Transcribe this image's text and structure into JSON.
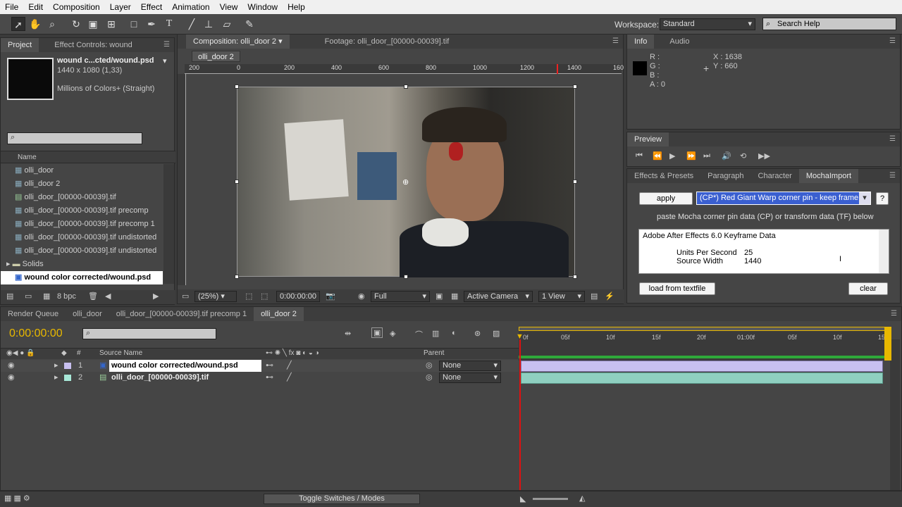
{
  "menu": [
    "File",
    "Edit",
    "Composition",
    "Layer",
    "Effect",
    "Animation",
    "View",
    "Window",
    "Help"
  ],
  "toolbar": {
    "workspace_label": "Workspace:",
    "workspace_value": "Standard",
    "search_placeholder": "Search Help"
  },
  "project": {
    "tab_project": "Project",
    "tab_effect_controls": "Effect Controls: wound",
    "item_name": "wound c...cted/wound.psd",
    "item_dims": "1440 x 1080 (1,33)",
    "item_color": "Millions of Colors+ (Straight)",
    "col_name": "Name",
    "files": [
      "olli_door",
      "olli_door 2",
      "olli_door_[00000-00039].tif",
      "olli_door_[00000-00039].tif precomp",
      "olli_door_[00000-00039].tif precomp 1",
      "olli_door_[00000-00039].tif undistorted",
      "olli_door_[00000-00039].tif undistorted",
      "Solids",
      "wound color corrected/wound.psd"
    ],
    "bpc": "8 bpc"
  },
  "comp": {
    "tab_comp": "Composition: olli_door 2",
    "tab_footage": "Footage: olli_door_[00000-00039].tif",
    "crumb": "olli_door 2",
    "ruler": [
      "200",
      "0",
      "200",
      "400",
      "600",
      "800",
      "1000",
      "1200",
      "1400",
      "160"
    ],
    "zoom": "(25%)",
    "timecode": "0:00:00:00",
    "resolution": "Full",
    "camera": "Active Camera",
    "view": "1 View"
  },
  "info": {
    "tab_info": "Info",
    "tab_audio": "Audio",
    "r": "R :",
    "g": "G :",
    "b": "B :",
    "a": "A : 0",
    "x": "X : 1638",
    "y": "Y : 660"
  },
  "preview": {
    "tab": "Preview"
  },
  "mocha": {
    "tab_effects": "Effects & Presets",
    "tab_paragraph": "Paragraph",
    "tab_character": "Character",
    "tab_mocha": "MochaImport",
    "apply": "apply",
    "mode": "(CP*) Red Giant Warp corner pin - keep frame",
    "help": "?",
    "instructions": "paste Mocha corner pin data (CP) or transform data (TF) below",
    "text_line1": "Adobe After Effects 6.0 Keyframe Data",
    "text_line2_label": "Units Per Second",
    "text_line2_value": "25",
    "text_line3_label": "Source Width",
    "text_line3_value": "1440",
    "load": "load from textfile",
    "clear": "clear"
  },
  "timeline": {
    "tabs": [
      "Render Queue",
      "olli_door",
      "olli_door_[00000-00039].tif precomp 1",
      "olli_door 2"
    ],
    "timecode": "0:00:00:00",
    "col_num": "#",
    "col_source": "Source Name",
    "col_parent": "Parent",
    "layers": [
      {
        "num": "1",
        "name": "wound color corrected/wound.psd",
        "parent": "None",
        "color": "#c8c0f0"
      },
      {
        "num": "2",
        "name": "olli_door_[00000-00039].tif",
        "parent": "None",
        "color": "#a8e8d8"
      }
    ],
    "ticks": [
      "0f",
      "05f",
      "10f",
      "15f",
      "20f",
      "01:00f",
      "05f",
      "10f",
      "15f"
    ],
    "toggle": "Toggle Switches / Modes"
  }
}
